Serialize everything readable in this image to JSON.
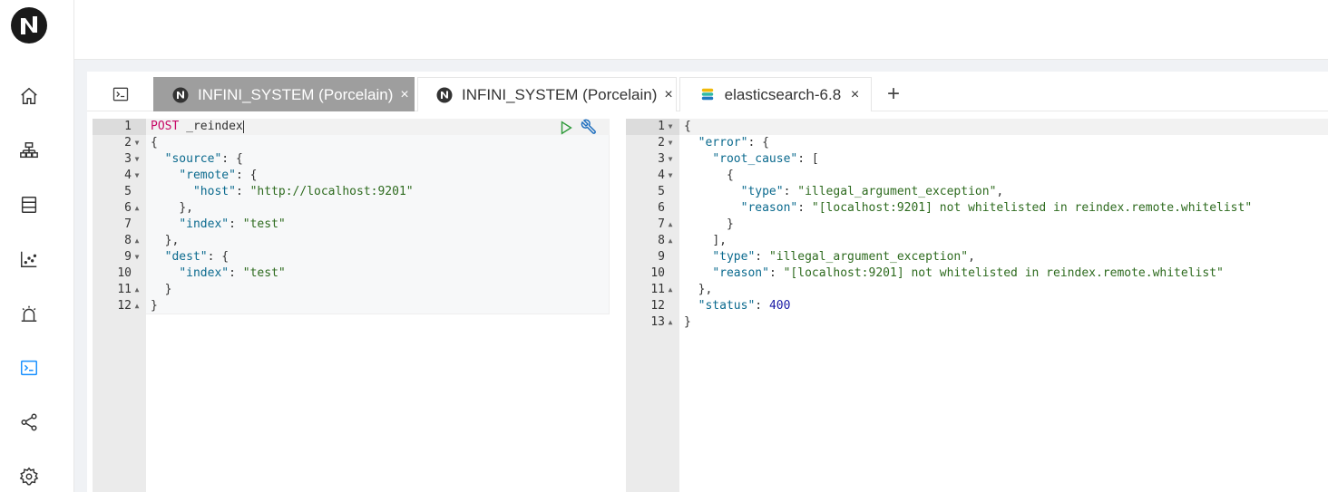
{
  "sidebar": {
    "items": [
      {
        "name": "home"
      },
      {
        "name": "cluster"
      },
      {
        "name": "data"
      },
      {
        "name": "insight"
      },
      {
        "name": "alerting"
      },
      {
        "name": "console",
        "active": true
      },
      {
        "name": "gateway"
      },
      {
        "name": "settings"
      }
    ]
  },
  "tabs": [
    {
      "label": "INFINI_SYSTEM (Porcelain)",
      "icon": "infini-logo-icon",
      "active": true
    },
    {
      "label": "INFINI_SYSTEM (Porcelain)",
      "icon": "infini-logo-icon",
      "active": false
    },
    {
      "label": "elasticsearch-6.8",
      "icon": "elasticsearch-icon",
      "active": false
    }
  ],
  "add_tab_label": "+",
  "close_glyph": "×",
  "colors": {
    "accent": "#1890ff",
    "active_tab_bg": "#9e9e9e",
    "keyword": "#c80a68",
    "key": "#0b6a8e",
    "string": "#2e6b1f",
    "number": "#1a1aa6"
  },
  "request": {
    "lines": [
      {
        "n": "1",
        "fold": "",
        "text": "POST _reindex"
      },
      {
        "n": "2",
        "fold": "▼",
        "text": "{"
      },
      {
        "n": "3",
        "fold": "▼",
        "text": "  \"source\": {"
      },
      {
        "n": "4",
        "fold": "▼",
        "text": "    \"remote\": {"
      },
      {
        "n": "5",
        "fold": "",
        "text": "      \"host\": \"http://localhost:9201\""
      },
      {
        "n": "6",
        "fold": "▲",
        "text": "    },"
      },
      {
        "n": "7",
        "fold": "",
        "text": "    \"index\": \"test\""
      },
      {
        "n": "8",
        "fold": "▲",
        "text": "  },"
      },
      {
        "n": "9",
        "fold": "▼",
        "text": "  \"dest\": {"
      },
      {
        "n": "10",
        "fold": "",
        "text": "    \"index\": \"test\""
      },
      {
        "n": "11",
        "fold": "▲",
        "text": "  }"
      },
      {
        "n": "12",
        "fold": "▲",
        "text": "}"
      }
    ]
  },
  "response": {
    "lines": [
      {
        "n": "1",
        "fold": "▼",
        "text": "{"
      },
      {
        "n": "2",
        "fold": "▼",
        "text": "  \"error\": {"
      },
      {
        "n": "3",
        "fold": "▼",
        "text": "    \"root_cause\": ["
      },
      {
        "n": "4",
        "fold": "▼",
        "text": "      {"
      },
      {
        "n": "5",
        "fold": "",
        "text": "        \"type\": \"illegal_argument_exception\","
      },
      {
        "n": "6",
        "fold": "",
        "text": "        \"reason\": \"[localhost:9201] not whitelisted in reindex.remote.whitelist\""
      },
      {
        "n": "7",
        "fold": "▲",
        "text": "      }"
      },
      {
        "n": "8",
        "fold": "▲",
        "text": "    ],"
      },
      {
        "n": "9",
        "fold": "",
        "text": "    \"type\": \"illegal_argument_exception\","
      },
      {
        "n": "10",
        "fold": "",
        "text": "    \"reason\": \"[localhost:9201] not whitelisted in reindex.remote.whitelist\""
      },
      {
        "n": "11",
        "fold": "▲",
        "text": "  },"
      },
      {
        "n": "12",
        "fold": "",
        "text": "  \"status\": 400"
      },
      {
        "n": "13",
        "fold": "▲",
        "text": "}"
      }
    ]
  }
}
